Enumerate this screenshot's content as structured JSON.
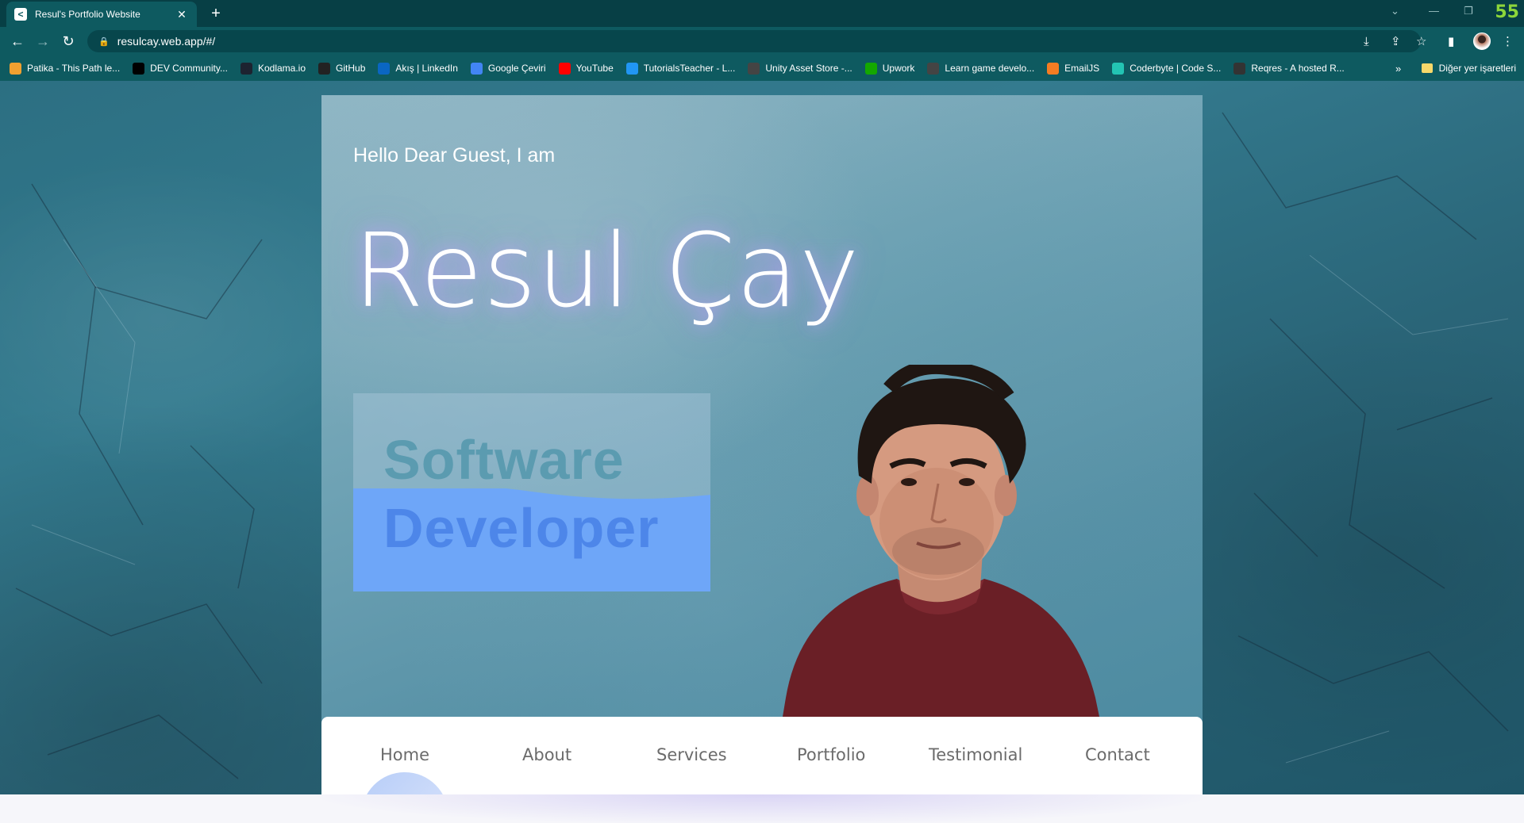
{
  "browser": {
    "tab_title": "Resul's Portfolio Website",
    "tab_favicon": "portfolio-icon",
    "url": "resulcay.web.app/#/",
    "counter": "55",
    "bookmarks": [
      {
        "label": "Patika - This Path le...",
        "icon": "patika-icon",
        "color": "#f0a030"
      },
      {
        "label": "DEV Community...",
        "icon": "dev-icon",
        "color": "#000000"
      },
      {
        "label": "Kodlama.io",
        "icon": "kodlama-icon",
        "color": "#1d2330"
      },
      {
        "label": "GitHub",
        "icon": "github-icon",
        "color": "#222222"
      },
      {
        "label": "Akış | LinkedIn",
        "icon": "linkedin-icon",
        "color": "#0a66c2"
      },
      {
        "label": "Google Çeviri",
        "icon": "translate-icon",
        "color": "#4285f4"
      },
      {
        "label": "YouTube",
        "icon": "youtube-icon",
        "color": "#ff0000"
      },
      {
        "label": "TutorialsTeacher - L...",
        "icon": "tutorialsteacher-icon",
        "color": "#2196f3"
      },
      {
        "label": "Unity Asset Store -...",
        "icon": "unity-icon",
        "color": "#444444"
      },
      {
        "label": "Upwork",
        "icon": "upwork-icon",
        "color": "#14a800"
      },
      {
        "label": "Learn game develo...",
        "icon": "unity-learn-icon",
        "color": "#444444"
      },
      {
        "label": "EmailJS",
        "icon": "emailjs-icon",
        "color": "#f57c22"
      },
      {
        "label": "Coderbyte | Code S...",
        "icon": "coderbyte-icon",
        "color": "#23c4b3"
      },
      {
        "label": "Reqres - A hosted R...",
        "icon": "reqres-icon",
        "color": "#333333"
      }
    ],
    "more_bookmarks": "»",
    "other_bookmarks": "Diğer yer işaretleri"
  },
  "hero": {
    "greeting": "Hello Dear Guest, I am",
    "name": "Resul Çay",
    "role_line1": "Software",
    "role_line2": "Developer"
  },
  "nav": {
    "items": [
      "Home",
      "About",
      "Services",
      "Portfolio",
      "Testimonial",
      "Contact"
    ]
  },
  "colors": {
    "chrome_dark": "#073f45",
    "chrome": "#0e5a60",
    "role_accent": "#4d86e9",
    "wave_fill": "#6ea6f8"
  }
}
